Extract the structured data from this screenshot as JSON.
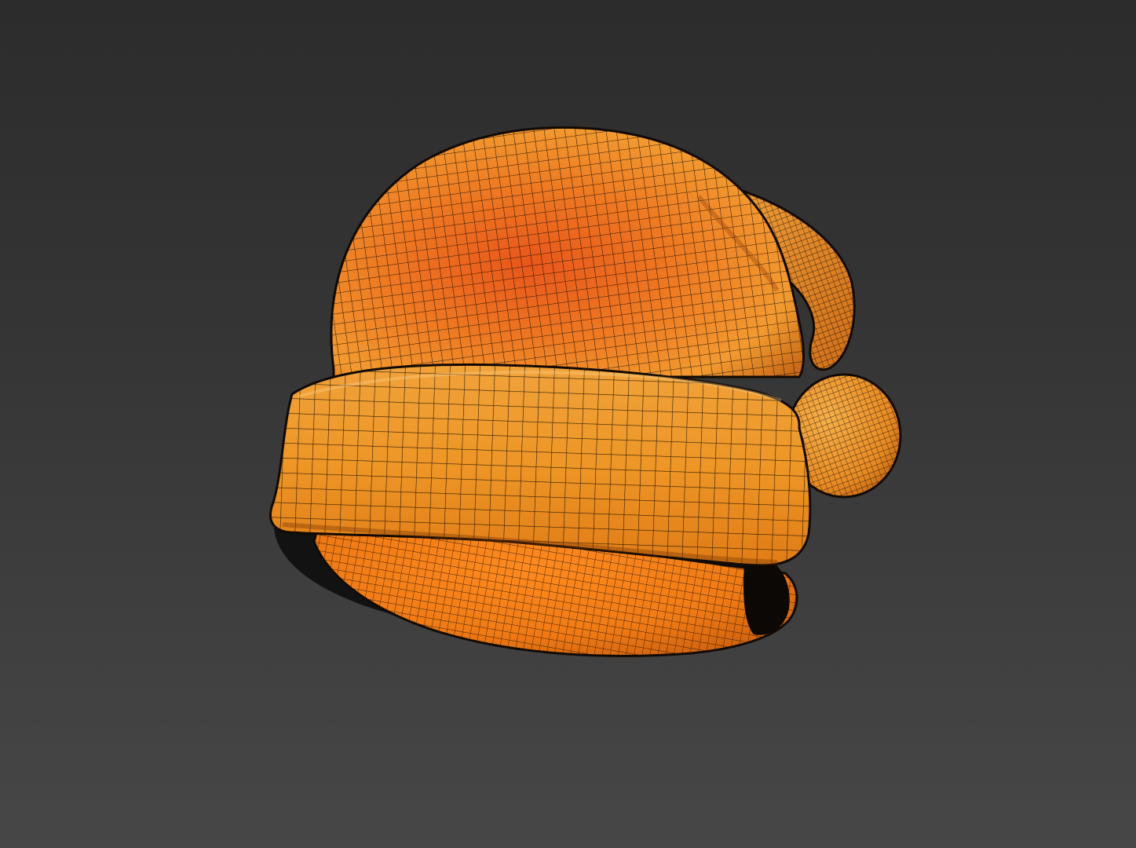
{
  "scene": {
    "subject": "santa-hat-wireframe-model",
    "colors": {
      "background_top": "#2c2c2c",
      "background_bottom": "#474747",
      "surface_light": "#f29a2e",
      "surface_mid": "#e8701a",
      "surface_dark": "#b8460a",
      "brim_light": "#f2a43a",
      "wire": "#1a0e05",
      "shadow": "#0a0a0a"
    },
    "parts": [
      "crown",
      "tail",
      "pompom",
      "brim",
      "inner-cap"
    ]
  }
}
